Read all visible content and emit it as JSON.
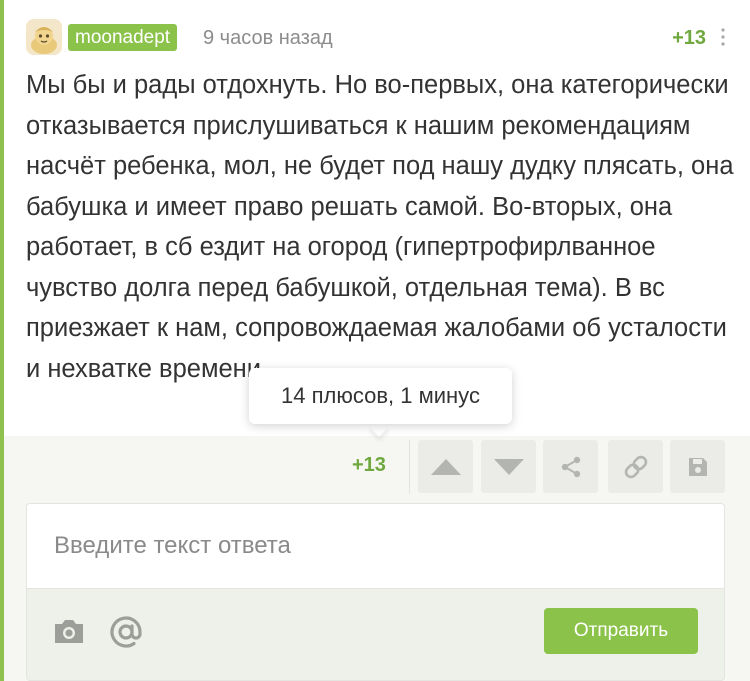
{
  "comment": {
    "author": "moonadept",
    "timestamp": "9 часов назад",
    "rating": "+13",
    "text": "Мы бы и рады отдохнуть. Но во-первых, она категорически отказывается прислушиваться к нашим рекомендациям насчёт ребенка, мол, не будет под нашу дудку плясать, она бабушка и имеет право решать самой. Во-вторых, она работает, в сб ездит на огород (гипертрофирлванное чувство долга перед бабушкой, отдельная тема). В вс приезжает к нам, сопровождаемая жалобами об усталости и нехватке времени."
  },
  "tooltip": {
    "text": "14 плюсов, 1 минус"
  },
  "actions": {
    "rating": "+13",
    "icons": [
      "arrow-up-icon",
      "arrow-down-icon",
      "share-icon",
      "link-icon",
      "save-icon"
    ]
  },
  "reply": {
    "placeholder": "Введите текст ответа",
    "submit_label": "Отправить",
    "icons": [
      "camera-icon",
      "at-icon"
    ]
  },
  "colors": {
    "accent": "#8bc34a",
    "rating": "#6ea83f",
    "background": "#f6f7f2"
  }
}
